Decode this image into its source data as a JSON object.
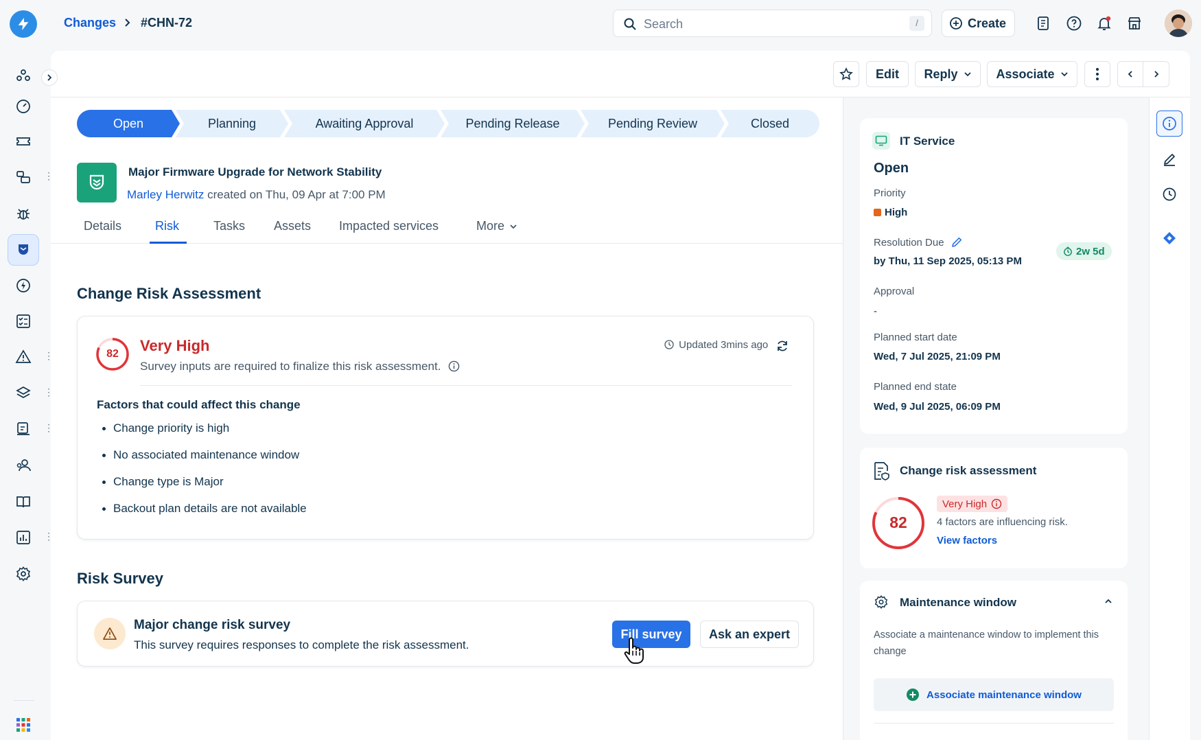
{
  "header": {
    "breadcrumb_parent": "Changes",
    "breadcrumb_current": "#CHN-72",
    "search_placeholder": "Search",
    "search_shortcut": "/",
    "create_label": "Create"
  },
  "toolbar": {
    "edit_label": "Edit",
    "reply_label": "Reply",
    "associate_label": "Associate"
  },
  "stages": [
    "Open",
    "Planning",
    "Awaiting Approval",
    "Pending Release",
    "Pending Review",
    "Closed"
  ],
  "ticket": {
    "title": "Major Firmware Upgrade for Network Stability",
    "author": "Marley Herwitz",
    "created_text": "created on Thu, 09 Apr at 7:00 PM"
  },
  "tabs": [
    "Details",
    "Risk",
    "Tasks",
    "Assets",
    "Impacted services",
    "More"
  ],
  "risk_assessment": {
    "heading": "Change Risk Assessment",
    "score": "82",
    "level": "Very High",
    "subtitle": "Survey inputs are required to finalize this risk assessment.",
    "updated": "Updated 3mins ago",
    "factors_heading": "Factors that could affect this change",
    "factors": [
      "Change priority is high",
      "No associated maintenance window",
      "Change type is Major",
      "Backout plan details are not available"
    ]
  },
  "risk_survey": {
    "heading": "Risk Survey",
    "title": "Major change risk survey",
    "subtitle": "This survey requires responses to complete the risk assessment.",
    "fill_label": "Fill survey",
    "expert_label": "Ask an expert"
  },
  "properties": {
    "service": "IT Service",
    "status": "Open",
    "priority_label": "Priority",
    "priority_value": "High",
    "resolution_label": "Resolution Due",
    "resolution_value": "by Thu, 11 Sep 2025, 05:13 PM",
    "sla_badge": "2w 5d",
    "approval_label": "Approval",
    "approval_value": "-",
    "start_label": "Planned start date",
    "start_value": "Wed, 7 Jul 2025, 21:09 PM",
    "end_label": "Planned end state",
    "end_value": "Wed, 9 Jul 2025, 06:09 PM"
  },
  "risk_card": {
    "title": "Change risk assessment",
    "score": "82",
    "level": "Very High",
    "factors_text": "4 factors are influencing risk.",
    "view_link": "View factors"
  },
  "maintenance": {
    "title": "Maintenance window",
    "description": "Associate a maintenance window to implement this change",
    "button_label": "Associate maintenance window"
  },
  "colors": {
    "primary": "#2971e6",
    "link": "#0f5bd6",
    "danger": "#e0353a",
    "priority_high": "#e2661c",
    "success": "#1aa37a"
  }
}
